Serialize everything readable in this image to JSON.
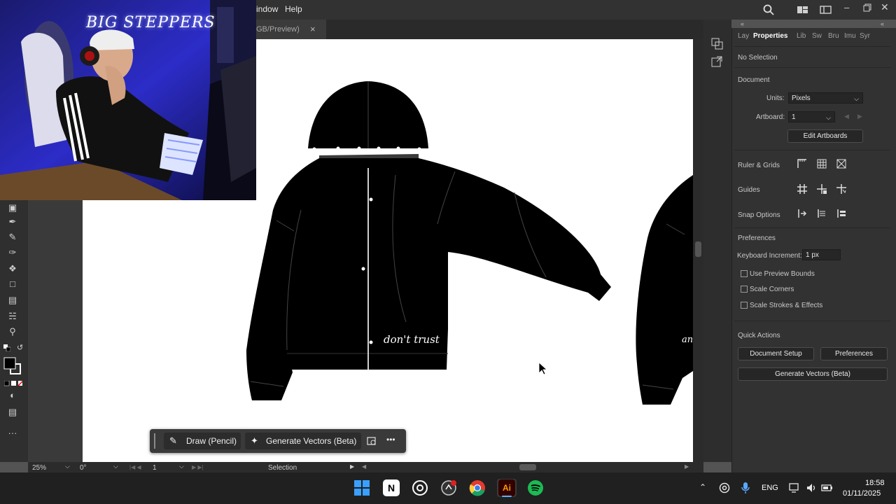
{
  "menubar": {
    "items": [
      "indow",
      "Help"
    ]
  },
  "doc_tab": {
    "label": "GB/Preview)",
    "close": "×"
  },
  "webcam": {
    "neon_text": "BIG STEPPERS"
  },
  "artwork": {
    "script_text": "don't trust",
    "script_text_right": "an"
  },
  "right_tabs": [
    "Lay",
    "Properties",
    "Lib",
    "Sw",
    "Bru",
    "Imu",
    "Syr"
  ],
  "properties": {
    "no_selection": "No Selection",
    "document_heading": "Document",
    "units_label": "Units:",
    "units_value": "Pixels",
    "artboard_label": "Artboard:",
    "artboard_value": "1",
    "edit_artboards": "Edit Artboards",
    "ruler_grids": "Ruler & Grids",
    "guides": "Guides",
    "snap_options": "Snap Options",
    "preferences_heading": "Preferences",
    "keyboard_increment_label": "Keyboard Increment:",
    "keyboard_increment_value": "1 px",
    "use_preview_bounds": "Use Preview Bounds",
    "scale_corners": "Scale Corners",
    "scale_strokes": "Scale Strokes & Effects",
    "quick_actions": "Quick Actions",
    "document_setup": "Document Setup",
    "preferences_btn": "Preferences",
    "generate_vectors": "Generate Vectors (Beta)"
  },
  "context_bar": {
    "draw_pencil": "Draw (Pencil)",
    "generate_vectors": "Generate Vectors (Beta)",
    "more": "•••"
  },
  "statusbar": {
    "zoom": "25%",
    "rotation": "0°",
    "artboard_num": "1",
    "tool": "Selection"
  },
  "taskbar": {
    "language": "ENG",
    "time": "18:58",
    "date": "01/11/2025"
  },
  "colors": {
    "accent_windows": "#1e90ff",
    "ai_brand": "#330000",
    "spotify": "#1db954"
  }
}
